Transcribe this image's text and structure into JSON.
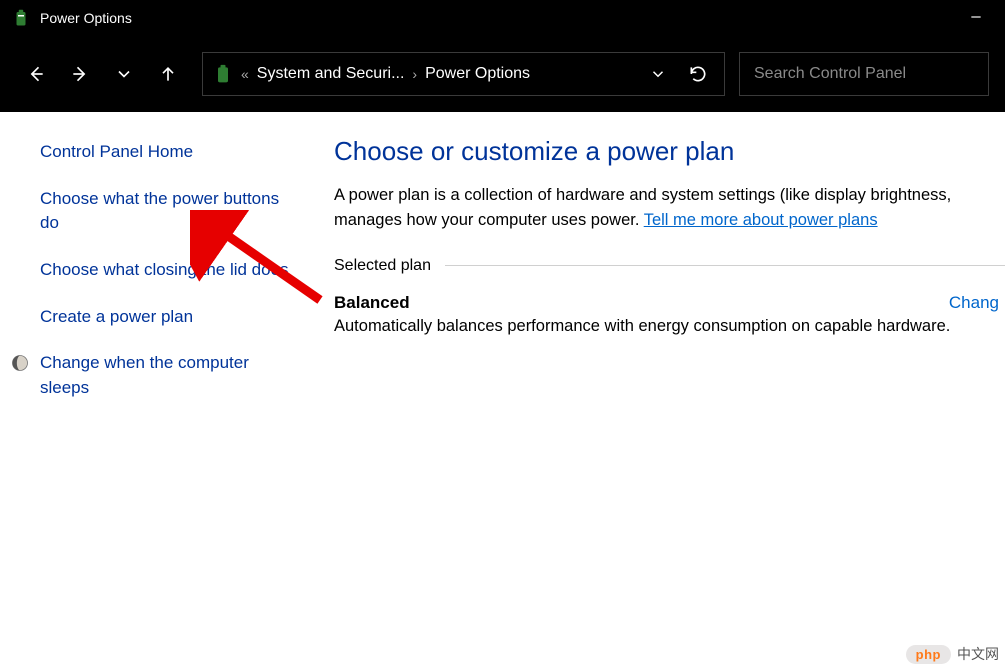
{
  "titlebar": {
    "title": "Power Options"
  },
  "breadcrumb": {
    "overflow_glyph": "«",
    "segments": [
      "System and Securi...",
      "Power Options"
    ]
  },
  "search": {
    "placeholder": "Search Control Panel"
  },
  "sidebar": {
    "links": [
      "Control Panel Home",
      "Choose what the power buttons do",
      "Choose what closing the lid does",
      "Create a power plan",
      "Change when the computer sleeps"
    ]
  },
  "main": {
    "heading": "Choose or customize a power plan",
    "description_prefix": "A power plan is a collection of hardware and system settings (like display brightness, manages how your computer uses power. ",
    "description_link": "Tell me more about power plans",
    "section_label": "Selected plan",
    "plan": {
      "name": "Balanced",
      "change_label": "Chang",
      "description": "Automatically balances performance with energy consumption on capable hardware."
    }
  },
  "watermark": {
    "badge": "php",
    "text": "中文网"
  }
}
